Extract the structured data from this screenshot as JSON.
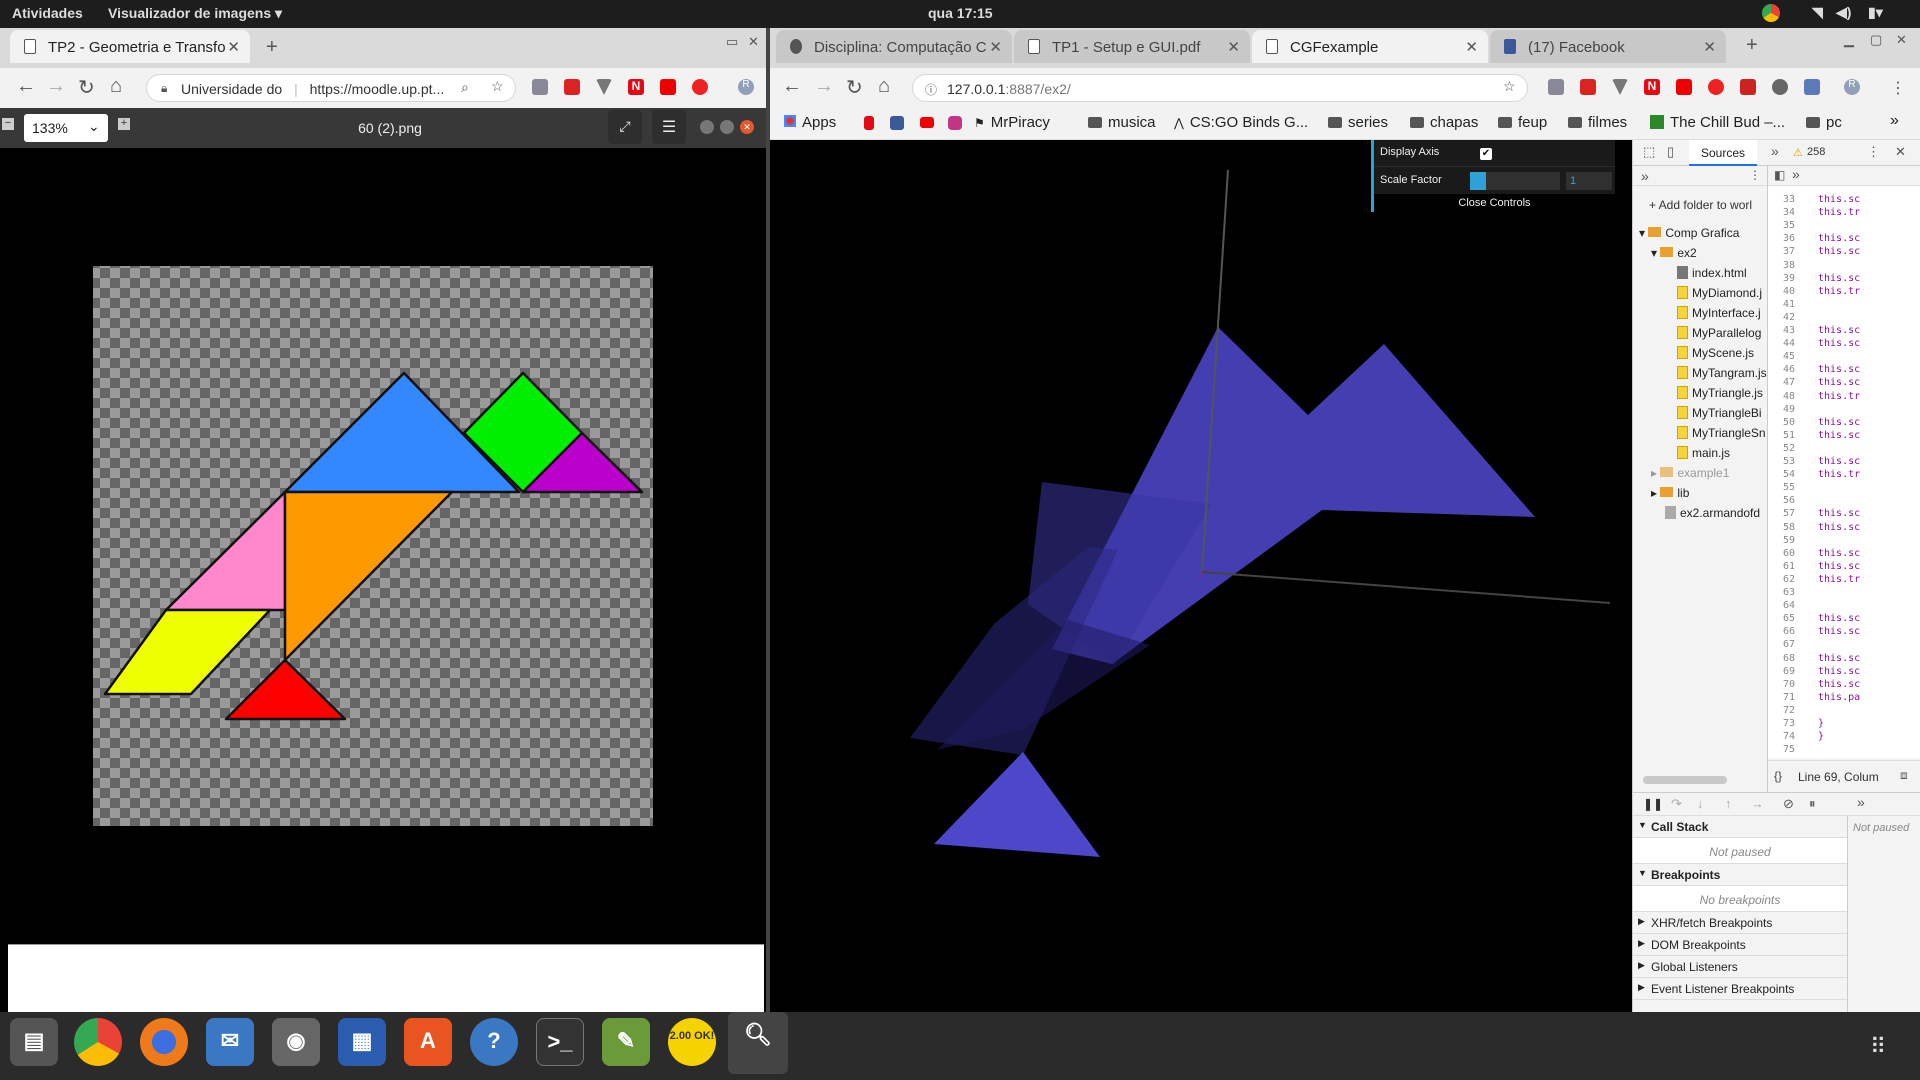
{
  "topbar": {
    "activities": "Atividades",
    "app_menu": "Visualizador de imagens ▾",
    "clock": "qua 17:15"
  },
  "left_browser": {
    "tab_title": "TP2 - Geometria e Transfo",
    "omnibox_site": "Universidade do",
    "omnibox_url": "https://moodle.up.pt..."
  },
  "image_viewer": {
    "zoom": "133%",
    "filename": "60 (2).png"
  },
  "right_browser": {
    "tabs": [
      "Disciplina: Computação C",
      "TP1 - Setup e GUI.pdf",
      "CGFexample",
      "(17) Facebook"
    ],
    "url_host": "127.0.0.1",
    "url_rest": ":8887/ex2/",
    "bookmarks": [
      "Apps",
      "MrPiracy",
      "musica",
      "CS:GO Binds G...",
      "series",
      "chapas",
      "feup",
      "filmes",
      "The Chill Bud –...",
      "pc"
    ]
  },
  "gui": {
    "display_axis": "Display Axis",
    "scale_factor": "Scale Factor",
    "scale_value": "1",
    "close": "Close Controls"
  },
  "devtools": {
    "tab_sources": "Sources",
    "warnings": "258",
    "add_folder": "+ Add folder to worl",
    "tree": {
      "root": "Comp Grafica",
      "ex2": "ex2",
      "files": [
        "index.html",
        "MyDiamond.j",
        "MyInterface.j",
        "MyParallelog",
        "MyScene.js",
        "MyTangram.js",
        "MyTriangle.js",
        "MyTriangleBi",
        "MyTriangleSn",
        "main.js"
      ],
      "example1": "example1",
      "lib": "lib",
      "other": "ex2.armandofd"
    },
    "line_numbers": [
      "33",
      "34",
      "35",
      "36",
      "37",
      "38",
      "39",
      "40",
      "41",
      "42",
      "43",
      "44",
      "45",
      "46",
      "47",
      "48",
      "49",
      "50",
      "51",
      "52",
      "53",
      "54",
      "55",
      "56",
      "57",
      "58",
      "59",
      "60",
      "61",
      "62",
      "63",
      "64",
      "65",
      "66",
      "67",
      "68",
      "69",
      "70",
      "71",
      "72",
      "73",
      "74",
      "75"
    ],
    "code_lines": [
      "this.sc",
      "this.tr",
      "",
      "this.sc",
      "this.sc",
      "",
      "this.sc",
      "this.tr",
      "",
      "",
      "this.sc",
      "this.sc",
      "",
      "this.sc",
      "this.sc",
      "this.tr",
      "",
      "this.sc",
      "this.sc",
      "",
      "this.sc",
      "this.tr",
      "",
      "",
      "this.sc",
      "this.sc",
      "",
      "this.sc",
      "this.sc",
      "this.tr",
      "",
      "",
      "this.sc",
      "this.sc",
      "",
      "this.sc",
      "this.sc",
      "this.sc",
      "this.pa",
      "",
      "  }",
      "}",
      ""
    ],
    "status": "Line 69, Colum",
    "call_stack": "Call Stack",
    "not_paused": "Not paused",
    "breakpoints": "Breakpoints",
    "no_breakpoints": "No breakpoints",
    "xhr": "XHR/fetch Breakpoints",
    "dom": "DOM Breakpoints",
    "global": "Global Listeners",
    "event": "Event Listener Breakpoints",
    "not_paused_right": "Not paused"
  },
  "dock": {
    "badge": "2.00 OK!"
  },
  "colors": {
    "tangram_blue": "#3388ff",
    "tangram_green": "#00ee00",
    "tangram_purple": "#bb00cc",
    "tangram_pink": "#ff88cc",
    "tangram_orange": "#ff9900",
    "tangram_yellow": "#eeff00",
    "tangram_red": "#ff0000",
    "scene_shape": "#4d47c9"
  }
}
